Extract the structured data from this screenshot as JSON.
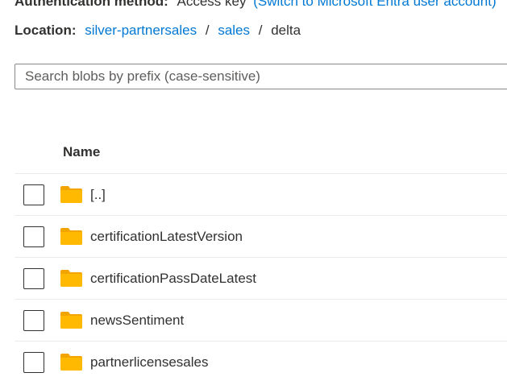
{
  "auth": {
    "label": "Authentication method:",
    "value": "Access key",
    "link": "(Switch to Microsoft Entra user account)"
  },
  "location": {
    "label": "Location:",
    "crumbs": [
      "silver-partnersales",
      "sales"
    ],
    "separator": "/",
    "current": "delta"
  },
  "search": {
    "placeholder": "Search blobs by prefix (case-sensitive)",
    "value": ""
  },
  "table": {
    "header_name": "Name",
    "rows": [
      {
        "name": "[..]",
        "icon": "folder-icon"
      },
      {
        "name": "certificationLatestVersion",
        "icon": "folder-icon"
      },
      {
        "name": "certificationPassDateLatest",
        "icon": "folder-icon"
      },
      {
        "name": "newsSentiment",
        "icon": "folder-icon"
      },
      {
        "name": "partnerlicensesales",
        "icon": "folder-icon"
      }
    ]
  },
  "colors": {
    "link": "#0078d4",
    "folder": "#ffb900",
    "folder_tab": "#f2a500",
    "text": "#323130"
  }
}
